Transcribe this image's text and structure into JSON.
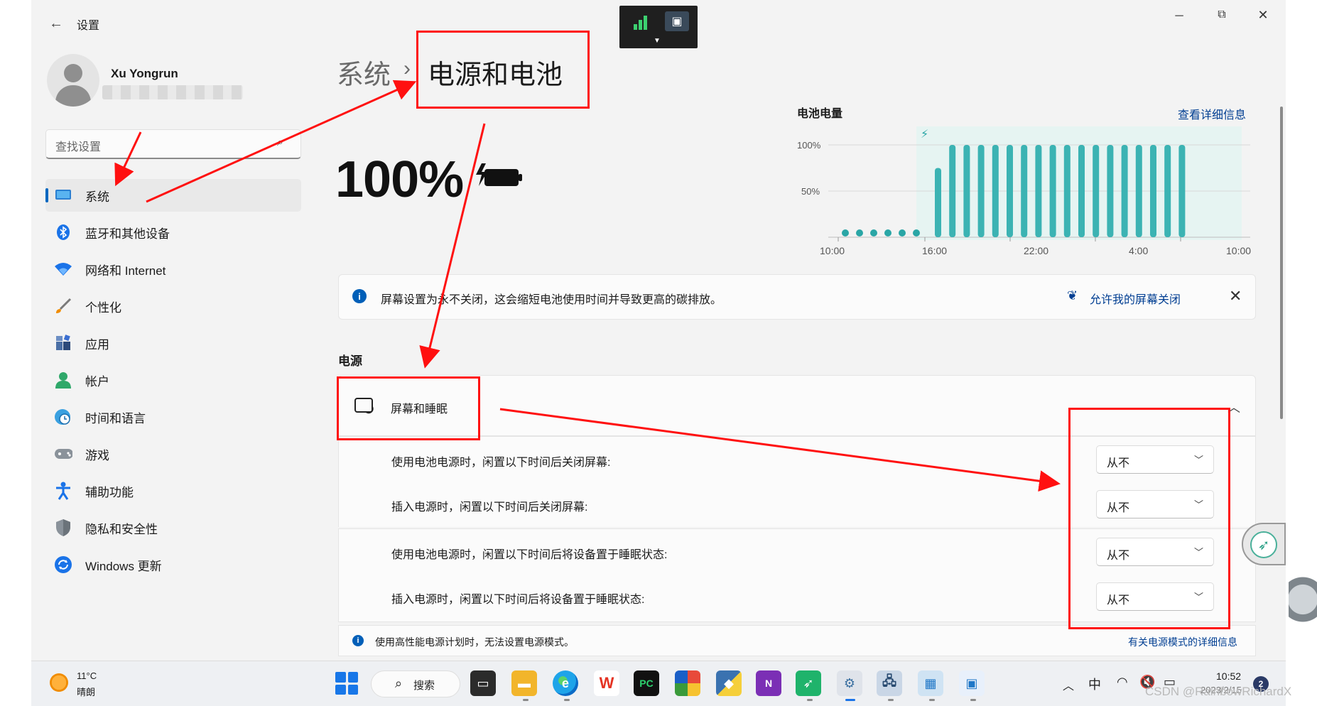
{
  "window": {
    "title": "设置",
    "controls": {
      "minimize": "─",
      "restore": "⧉",
      "close": "✕"
    }
  },
  "profile": {
    "name": "Xu Yongrun"
  },
  "search": {
    "placeholder": "查找设置"
  },
  "nav": {
    "items": [
      {
        "label": "系统",
        "icon": "system-icon",
        "active": true
      },
      {
        "label": "蓝牙和其他设备",
        "icon": "bluetooth-icon"
      },
      {
        "label": "网络和 Internet",
        "icon": "wifi-icon"
      },
      {
        "label": "个性化",
        "icon": "brush-icon"
      },
      {
        "label": "应用",
        "icon": "apps-icon"
      },
      {
        "label": "帐户",
        "icon": "account-icon"
      },
      {
        "label": "时间和语言",
        "icon": "clock-globe-icon"
      },
      {
        "label": "游戏",
        "icon": "gamepad-icon"
      },
      {
        "label": "辅助功能",
        "icon": "accessibility-icon"
      },
      {
        "label": "隐私和安全性",
        "icon": "shield-icon"
      },
      {
        "label": "Windows 更新",
        "icon": "update-icon"
      }
    ]
  },
  "breadcrumb": {
    "parent": "系统",
    "separator": "›",
    "current": "电源和电池"
  },
  "battery": {
    "percent_label": "100%",
    "percent": 100,
    "charging": true
  },
  "chart_data": {
    "type": "bar",
    "title": "电池电量",
    "link": "查看详细信息",
    "y_ticks": [
      "100%",
      "50%"
    ],
    "x_ticks": [
      "10:00",
      "16:00",
      "22:00",
      "4:00",
      "10:00"
    ],
    "ylim": [
      0,
      100
    ],
    "grid": true,
    "charging_marker": "⚡",
    "low_dot_count": 6,
    "values": [
      75,
      100,
      100,
      100,
      100,
      100,
      100,
      100,
      100,
      100,
      100,
      100,
      100,
      100,
      100,
      100,
      100,
      100
    ],
    "bar_color": "#3bb3b3",
    "dot_color": "#2aa6a6"
  },
  "notice": {
    "text": "屏幕设置为永不关闭，这会缩短电池使用时间并导致更高的碳排放。",
    "action": "允许我的屏幕关闭",
    "close": "✕"
  },
  "power": {
    "section_title": "电源",
    "card_title": "屏幕和睡眠",
    "rows": [
      {
        "label": "使用电池电源时，闲置以下时间后关闭屏幕:",
        "value": "从不"
      },
      {
        "label": "插入电源时，闲置以下时间后关闭屏幕:",
        "value": "从不"
      },
      {
        "label": "使用电池电源时，闲置以下时间后将设备置于睡眠状态:",
        "value": "从不"
      },
      {
        "label": "插入电源时，闲置以下时间后将设备置于睡眠状态:",
        "value": "从不"
      }
    ],
    "footer_text": "使用高性能电源计划时，无法设置电源模式。",
    "footer_link": "有关电源模式的详细信息"
  },
  "taskbar": {
    "weather_temp": "11°C",
    "weather_cond": "晴朗",
    "search_label": "搜索",
    "ime": "中",
    "time": "10:52",
    "date": "2023/2/15",
    "notification_count": "2"
  },
  "watermark": "CSDN @RainbowRichardX",
  "colors": {
    "accent": "#0067c0",
    "annotation": "#ff1010",
    "link": "#003e92"
  }
}
